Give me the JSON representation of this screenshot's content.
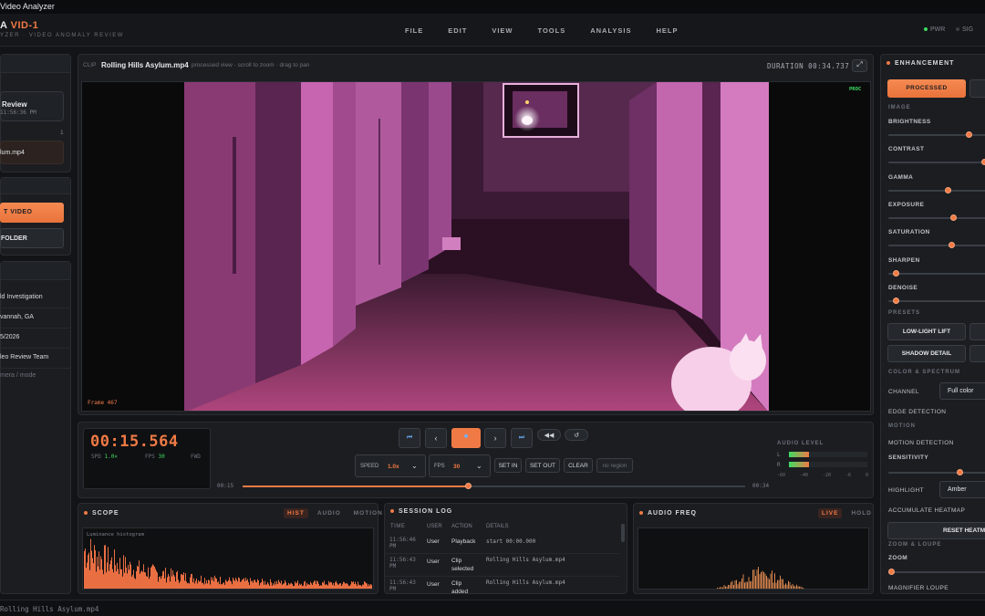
{
  "window": {
    "title": "Video Analyzer"
  },
  "brand": {
    "prefix": "A",
    "name": "VID-1",
    "subtitle": "YZER · VIDEO ANOMALY REVIEW"
  },
  "menu": [
    "FILE",
    "EDIT",
    "VIEW",
    "TOOLS",
    "ANALYSIS",
    "HELP"
  ],
  "status": {
    "pwr": "PWR",
    "sig": "SIG"
  },
  "left": {
    "session_title": "Review",
    "session_time": "11:56:36 PM",
    "count": "1",
    "clip_item": "lum.mp4",
    "import_label": "T VIDEO",
    "folder_label": "FOLDER",
    "meta": [
      "ld Investigation",
      "vannah, GA",
      "5/2026",
      "leo Review Team",
      "mera / mode"
    ]
  },
  "clip": {
    "label": "CLIP",
    "name": "Rolling Hills Asylum.mp4",
    "hint": "processed view · scroll to zoom · drag to pan",
    "duration_label": "DURATION",
    "duration": "00:34.737",
    "badge": "PROC",
    "frame": "Frame 467"
  },
  "transport": {
    "timecode": "00:15.564",
    "spd_label": "SPD",
    "spd": "1.0×",
    "fps_label": "FPS",
    "fps": "30",
    "dir": "FWD",
    "speed_label": "SPEED",
    "speed": "1.0x",
    "fps_sel_label": "FPS",
    "fps_sel": "30",
    "set_in": "SET IN",
    "set_out": "SET OUT",
    "clear": "CLEAR",
    "region": "no region",
    "t_start": "00:15",
    "t_end": "00:34",
    "progress": 0.45,
    "audio_label": "AUDIO LEVEL",
    "ch_l": "L",
    "ch_r": "R",
    "db_ticks": [
      "-60",
      "-40",
      "-20",
      "-6",
      "0"
    ]
  },
  "scope": {
    "title": "SCOPE",
    "tabs": [
      "HIST",
      "AUDIO",
      "MOTION"
    ],
    "active": "HIST",
    "caption": "Luminance histogram"
  },
  "log": {
    "title": "SESSION LOG",
    "headers": [
      "TIME",
      "USER",
      "ACTION",
      "DETAILS"
    ],
    "rows": [
      {
        "time": "11:56:46 PM",
        "user": "User",
        "action": "Playback",
        "details": "start 00:00.000"
      },
      {
        "time": "11:56:43 PM",
        "user": "User",
        "action": "Clip selected",
        "details": "Rolling Hills Asylum.mp4"
      },
      {
        "time": "11:56:43 PM",
        "user": "User",
        "action": "Clip added",
        "details": "Rolling Hills Asylum.mp4"
      }
    ]
  },
  "audio_freq": {
    "title": "AUDIO FREQ",
    "tabs": [
      "LIVE",
      "HOLD"
    ],
    "active": "LIVE"
  },
  "enhance": {
    "title": "ENHANCEMENT",
    "mode": "PROCESSED",
    "image_label": "IMAGE",
    "sliders": [
      {
        "label": "BRIGHTNESS",
        "value": 0.82
      },
      {
        "label": "CONTRAST",
        "value": 0.98
      },
      {
        "label": "GAMMA",
        "value": 0.6
      },
      {
        "label": "EXPOSURE",
        "value": 0.65
      },
      {
        "label": "SATURATION",
        "value": 0.63
      },
      {
        "label": "SHARPEN",
        "value": 0.05
      },
      {
        "label": "DENOISE",
        "value": 0.05
      }
    ],
    "presets_label": "PRESETS",
    "presets": [
      "LOW-LIGHT LIFT",
      "SHADOW DETAIL"
    ],
    "color_label": "COLOR & SPECTRUM",
    "channel_label": "CHANNEL",
    "channel": "Full color",
    "edge": "EDGE DETECTION",
    "motion_label": "MOTION",
    "motion_detect": "MOTION DETECTION",
    "sensitivity": "SENSITIVITY",
    "sensitivity_value": 0.72,
    "highlight_label": "HIGHLIGHT",
    "highlight": "Amber",
    "accumulate": "ACCUMULATE HEATMAP",
    "reset": "RESET HEATM",
    "zoom_label": "ZOOM & LOUPE",
    "zoom": "ZOOM",
    "loupe": "MAGNIFIER LOUPE"
  },
  "footer": {
    "file": "Rolling Hills Asylum.mp4"
  }
}
